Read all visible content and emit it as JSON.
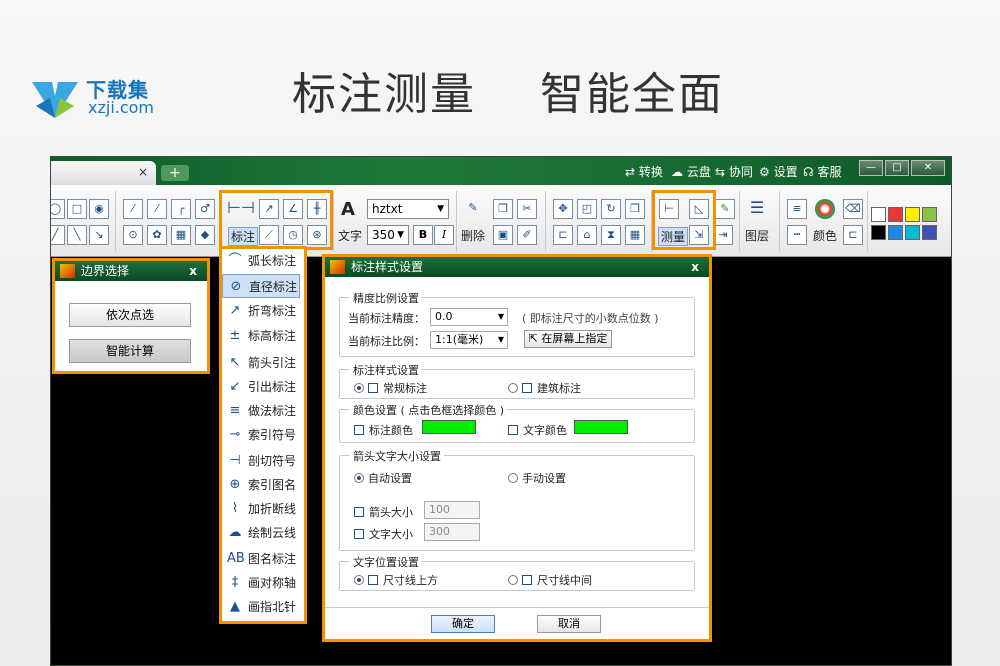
{
  "banner": {
    "logo_cn": "下载集",
    "logo_en": "xzji.com",
    "headline": "标注测量    智能全面"
  },
  "titlebar": {
    "tab_close": "×",
    "tab_add": "+",
    "menu": [
      {
        "icon": "convert-icon",
        "label": "⇄ 转换"
      },
      {
        "icon": "cloud-icon",
        "label": "☁ 云盘"
      },
      {
        "icon": "collaborate-icon",
        "label": "⇆ 协同"
      },
      {
        "icon": "gear-icon",
        "label": "⚙ 设置"
      },
      {
        "icon": "headset-icon",
        "label": "☊ 客服"
      }
    ],
    "window_buttons": [
      "—",
      "□",
      "✕"
    ]
  },
  "toolbar": {
    "dim_label": "标注",
    "text_label": "文字",
    "font_name": "hztxt",
    "font_size": "350",
    "bold": "B",
    "italic": "I",
    "delete_label": "删除",
    "measure_label": "测量",
    "layer_label": "图层",
    "color_label": "颜色",
    "text_glyph": "A",
    "swatches": [
      "#ffffff",
      "#e53935",
      "#ffee00",
      "#8bc34a",
      "#000000",
      "#1e88e5",
      "#00bcd4",
      "#3f51b5"
    ]
  },
  "boundary_panel": {
    "title": "边界选择",
    "close": "x",
    "btn_point": "依次点选",
    "btn_smart": "智能计算"
  },
  "dim_menu": {
    "items": [
      {
        "icon": "arc-length-icon",
        "glyph": "⌒",
        "label": "弧长标注"
      },
      {
        "icon": "diameter-icon",
        "glyph": "⊘",
        "label": "直径标注"
      },
      {
        "icon": "jogged-icon",
        "glyph": "↗",
        "label": "折弯标注"
      },
      {
        "icon": "elevation-icon",
        "glyph": "±",
        "label": "标高标注"
      },
      {
        "icon": "arrow-leader-icon",
        "glyph": "↖",
        "label": "箭头引注"
      },
      {
        "icon": "leader-out-icon",
        "glyph": "↙",
        "label": "引出标注"
      },
      {
        "icon": "method-dim-icon",
        "glyph": "≡",
        "label": "做法标注"
      },
      {
        "icon": "index-symbol-icon",
        "glyph": "⊸",
        "label": "索引符号"
      },
      {
        "icon": "section-symbol-icon",
        "glyph": "⊣",
        "label": "剖切符号"
      },
      {
        "icon": "index-drawing-icon",
        "glyph": "⊕",
        "label": "索引图名"
      },
      {
        "icon": "break-line-icon",
        "glyph": "⌇",
        "label": "加折断线"
      },
      {
        "icon": "revision-cloud-icon",
        "glyph": "☁",
        "label": "绘制云线"
      },
      {
        "icon": "drawing-name-icon",
        "glyph": "AB",
        "label": "图名标注"
      },
      {
        "icon": "symmetry-axis-icon",
        "glyph": "‡",
        "label": "画对称轴"
      },
      {
        "icon": "north-arrow-icon",
        "glyph": "▲",
        "label": "画指北针"
      }
    ],
    "highlighted_index": 1
  },
  "dim_style_dialog": {
    "title": "标注样式设置",
    "close": "x",
    "precision_group": "精度比例设置",
    "precision_label": "当前标注精度：",
    "precision_value": "0.0",
    "precision_hint": "( 即标注尺寸的小数点位数 )",
    "scale_label": "当前标注比例：",
    "scale_value": "1:1(毫米)",
    "pick_on_screen": "在屏幕上指定",
    "style_group": "标注样式设置",
    "style_normal": "常规标注",
    "style_arch": "建筑标注",
    "color_group": "颜色设置 ( 点击色框选择颜色 )",
    "dim_color_label": "标注颜色",
    "text_color_label": "文字颜色",
    "dim_color": "#00ee00",
    "text_color": "#00ee00",
    "size_group": "箭头文字大小设置",
    "size_auto": "自动设置",
    "size_manual": "手动设置",
    "arrow_size_label": "箭头大小",
    "arrow_size_value": "100",
    "text_size_label": "文字大小",
    "text_size_value": "300",
    "pos_group": "文字位置设置",
    "pos_above": "尺寸线上方",
    "pos_middle": "尺寸线中间",
    "ok": "确定",
    "cancel": "取消"
  }
}
